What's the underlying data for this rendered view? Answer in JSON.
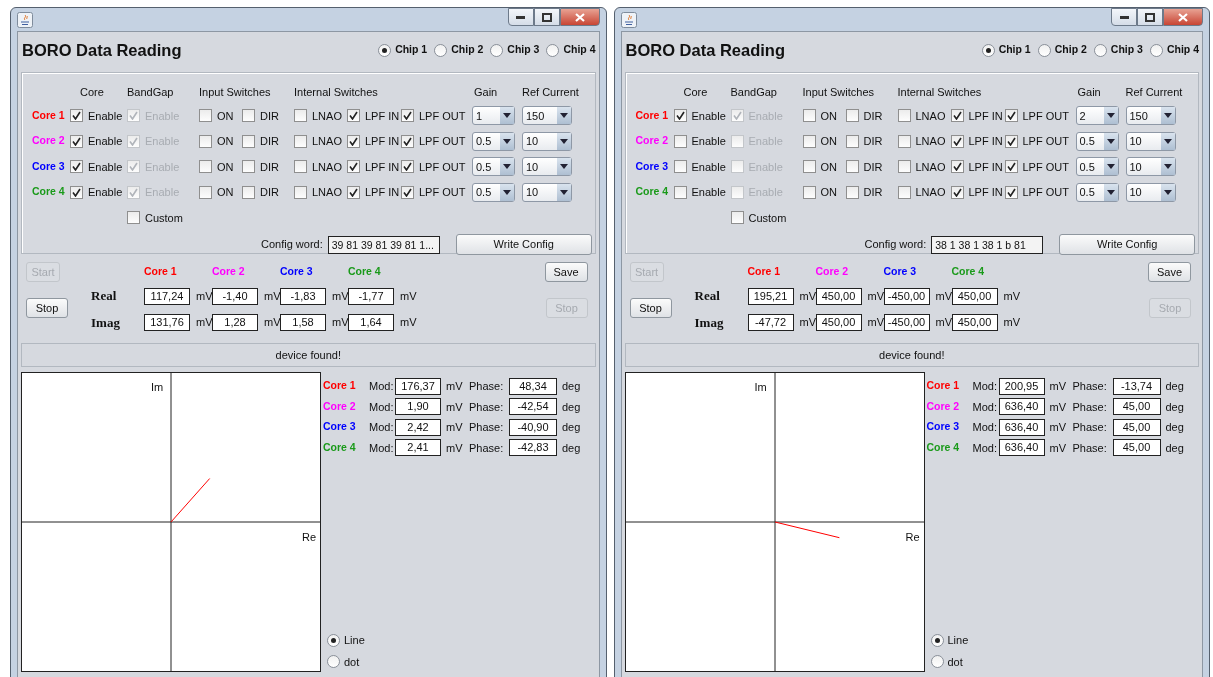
{
  "windows": [
    {
      "title": "BORO Data Reading",
      "chips": [
        {
          "label": "Chip 1",
          "selected": true
        },
        {
          "label": "Chip 2",
          "selected": false
        },
        {
          "label": "Chip 3",
          "selected": false
        },
        {
          "label": "Chip 4",
          "selected": false
        }
      ],
      "config": {
        "headers": [
          "Core",
          "BandGap",
          "Input Switches",
          "Internal Switches",
          "Gain",
          "Ref Current"
        ],
        "cores": [
          {
            "label": "Core 1",
            "color": "#ff0000",
            "switches": [
              {
                "label": "Enable",
                "checked": true,
                "disabled": false
              },
              {
                "label": "Enable",
                "checked": true,
                "disabled": true
              },
              {
                "label": "ON",
                "checked": false,
                "disabled": false
              },
              {
                "label": "DIR",
                "checked": false,
                "disabled": false
              },
              {
                "label": "LNAO",
                "checked": false,
                "disabled": false
              },
              {
                "label": "LPF IN",
                "checked": true,
                "disabled": false
              },
              {
                "label": "LPF OUT",
                "checked": true,
                "disabled": false
              }
            ],
            "gain": "1",
            "ref_current": "150"
          },
          {
            "label": "Core 2",
            "color": "#ff00ff",
            "switches": [
              {
                "label": "Enable",
                "checked": true,
                "disabled": false
              },
              {
                "label": "Enable",
                "checked": true,
                "disabled": true
              },
              {
                "label": "ON",
                "checked": false,
                "disabled": false
              },
              {
                "label": "DIR",
                "checked": false,
                "disabled": false
              },
              {
                "label": "LNAO",
                "checked": false,
                "disabled": false
              },
              {
                "label": "LPF IN",
                "checked": true,
                "disabled": false
              },
              {
                "label": "LPF OUT",
                "checked": true,
                "disabled": false
              }
            ],
            "gain": "0.5",
            "ref_current": "10"
          },
          {
            "label": "Core 3",
            "color": "#0000ff",
            "switches": [
              {
                "label": "Enable",
                "checked": true,
                "disabled": false
              },
              {
                "label": "Enable",
                "checked": true,
                "disabled": true
              },
              {
                "label": "ON",
                "checked": false,
                "disabled": false
              },
              {
                "label": "DIR",
                "checked": false,
                "disabled": false
              },
              {
                "label": "LNAO",
                "checked": false,
                "disabled": false
              },
              {
                "label": "LPF IN",
                "checked": true,
                "disabled": false
              },
              {
                "label": "LPF OUT",
                "checked": true,
                "disabled": false
              }
            ],
            "gain": "0.5",
            "ref_current": "10"
          },
          {
            "label": "Core 4",
            "color": "#1a9a1a",
            "switches": [
              {
                "label": "Enable",
                "checked": true,
                "disabled": false
              },
              {
                "label": "Enable",
                "checked": true,
                "disabled": true
              },
              {
                "label": "ON",
                "checked": false,
                "disabled": false
              },
              {
                "label": "DIR",
                "checked": false,
                "disabled": false
              },
              {
                "label": "LNAO",
                "checked": false,
                "disabled": false
              },
              {
                "label": "LPF IN",
                "checked": true,
                "disabled": false
              },
              {
                "label": "LPF OUT",
                "checked": true,
                "disabled": false
              }
            ],
            "gain": "0.5",
            "ref_current": "10"
          }
        ],
        "custom": {
          "label": "Custom",
          "checked": false
        },
        "config_word_label": "Config word:",
        "config_word": "39 81 39 81 39 81 1...",
        "write_button": "Write Config"
      },
      "acquisition": {
        "start": {
          "label": "Start",
          "disabled": true
        },
        "stop": {
          "label": "Stop",
          "disabled": false
        },
        "save": {
          "label": "Save",
          "disabled": false
        },
        "stop_right": {
          "label": "Stop",
          "disabled": true
        },
        "columns": [
          {
            "label": "Core 1",
            "color": "#ff0000"
          },
          {
            "label": "Core 2",
            "color": "#ff00ff"
          },
          {
            "label": "Core 3",
            "color": "#0000ff"
          },
          {
            "label": "Core 4",
            "color": "#1a9a1a"
          }
        ],
        "rows": [
          {
            "label": "Real",
            "cells": [
              {
                "value": "117,24",
                "unit": "mV"
              },
              {
                "value": "-1,40",
                "unit": "mV"
              },
              {
                "value": "-1,83",
                "unit": "mV"
              },
              {
                "value": "-1,77",
                "unit": "mV"
              }
            ]
          },
          {
            "label": "Imag",
            "cells": [
              {
                "value": "131,76",
                "unit": "mV"
              },
              {
                "value": "1,28",
                "unit": "mV"
              },
              {
                "value": "1,58",
                "unit": "mV"
              },
              {
                "value": "1,64",
                "unit": "mV"
              }
            ]
          }
        ]
      },
      "status": "device found!",
      "plot": {
        "im_label": "Im",
        "re_label": "Re"
      },
      "polar": [
        {
          "label": "Core 1",
          "color": "#ff0000",
          "mod_label": "Mod:",
          "mod": "176,37",
          "mod_unit": "mV",
          "phase_label": "Phase:",
          "phase": "48,34",
          "phase_unit": "deg"
        },
        {
          "label": "Core 2",
          "color": "#ff00ff",
          "mod_label": "Mod:",
          "mod": "1,90",
          "mod_unit": "mV",
          "phase_label": "Phase:",
          "phase": "-42,54",
          "phase_unit": "deg"
        },
        {
          "label": "Core 3",
          "color": "#0000ff",
          "mod_label": "Mod:",
          "mod": "2,42",
          "mod_unit": "mV",
          "phase_label": "Phase:",
          "phase": "-40,90",
          "phase_unit": "deg"
        },
        {
          "label": "Core 4",
          "color": "#1a9a1a",
          "mod_label": "Mod:",
          "mod": "2,41",
          "mod_unit": "mV",
          "phase_label": "Phase:",
          "phase": "-42,83",
          "phase_unit": "deg"
        }
      ],
      "plot_modes": [
        {
          "label": "Line",
          "selected": true
        },
        {
          "label": "dot",
          "selected": false
        }
      ]
    },
    {
      "title": "BORO Data Reading",
      "chips": [
        {
          "label": "Chip 1",
          "selected": true
        },
        {
          "label": "Chip 2",
          "selected": false
        },
        {
          "label": "Chip 3",
          "selected": false
        },
        {
          "label": "Chip 4",
          "selected": false
        }
      ],
      "config": {
        "headers": [
          "Core",
          "BandGap",
          "Input Switches",
          "Internal Switches",
          "Gain",
          "Ref Current"
        ],
        "cores": [
          {
            "label": "Core 1",
            "color": "#ff0000",
            "switches": [
              {
                "label": "Enable",
                "checked": true,
                "disabled": false
              },
              {
                "label": "Enable",
                "checked": true,
                "disabled": true
              },
              {
                "label": "ON",
                "checked": false,
                "disabled": false
              },
              {
                "label": "DIR",
                "checked": false,
                "disabled": false
              },
              {
                "label": "LNAO",
                "checked": false,
                "disabled": false
              },
              {
                "label": "LPF IN",
                "checked": true,
                "disabled": false
              },
              {
                "label": "LPF OUT",
                "checked": true,
                "disabled": false
              }
            ],
            "gain": "2",
            "ref_current": "150"
          },
          {
            "label": "Core 2",
            "color": "#ff00ff",
            "switches": [
              {
                "label": "Enable",
                "checked": false,
                "disabled": false
              },
              {
                "label": "Enable",
                "checked": false,
                "disabled": true
              },
              {
                "label": "ON",
                "checked": false,
                "disabled": false
              },
              {
                "label": "DIR",
                "checked": false,
                "disabled": false
              },
              {
                "label": "LNAO",
                "checked": false,
                "disabled": false
              },
              {
                "label": "LPF IN",
                "checked": true,
                "disabled": false
              },
              {
                "label": "LPF OUT",
                "checked": true,
                "disabled": false
              }
            ],
            "gain": "0.5",
            "ref_current": "10"
          },
          {
            "label": "Core 3",
            "color": "#0000ff",
            "switches": [
              {
                "label": "Enable",
                "checked": false,
                "disabled": false
              },
              {
                "label": "Enable",
                "checked": false,
                "disabled": true
              },
              {
                "label": "ON",
                "checked": false,
                "disabled": false
              },
              {
                "label": "DIR",
                "checked": false,
                "disabled": false
              },
              {
                "label": "LNAO",
                "checked": false,
                "disabled": false
              },
              {
                "label": "LPF IN",
                "checked": true,
                "disabled": false
              },
              {
                "label": "LPF OUT",
                "checked": true,
                "disabled": false
              }
            ],
            "gain": "0.5",
            "ref_current": "10"
          },
          {
            "label": "Core 4",
            "color": "#1a9a1a",
            "switches": [
              {
                "label": "Enable",
                "checked": false,
                "disabled": false
              },
              {
                "label": "Enable",
                "checked": false,
                "disabled": true
              },
              {
                "label": "ON",
                "checked": false,
                "disabled": false
              },
              {
                "label": "DIR",
                "checked": false,
                "disabled": false
              },
              {
                "label": "LNAO",
                "checked": false,
                "disabled": false
              },
              {
                "label": "LPF IN",
                "checked": true,
                "disabled": false
              },
              {
                "label": "LPF OUT",
                "checked": true,
                "disabled": false
              }
            ],
            "gain": "0.5",
            "ref_current": "10"
          }
        ],
        "custom": {
          "label": "Custom",
          "checked": false
        },
        "config_word_label": "Config word:",
        "config_word": "38 1 38 1 38 1 b 81",
        "write_button": "Write Config"
      },
      "acquisition": {
        "start": {
          "label": "Start",
          "disabled": true
        },
        "stop": {
          "label": "Stop",
          "disabled": false
        },
        "save": {
          "label": "Save",
          "disabled": false
        },
        "stop_right": {
          "label": "Stop",
          "disabled": true
        },
        "columns": [
          {
            "label": "Core 1",
            "color": "#ff0000"
          },
          {
            "label": "Core 2",
            "color": "#ff00ff"
          },
          {
            "label": "Core 3",
            "color": "#0000ff"
          },
          {
            "label": "Core 4",
            "color": "#1a9a1a"
          }
        ],
        "rows": [
          {
            "label": "Real",
            "cells": [
              {
                "value": "195,21",
                "unit": "mV"
              },
              {
                "value": "450,00",
                "unit": "mV"
              },
              {
                "value": "-450,00",
                "unit": "mV"
              },
              {
                "value": "450,00",
                "unit": "mV"
              }
            ]
          },
          {
            "label": "Imag",
            "cells": [
              {
                "value": "-47,72",
                "unit": "mV"
              },
              {
                "value": "450,00",
                "unit": "mV"
              },
              {
                "value": "-450,00",
                "unit": "mV"
              },
              {
                "value": "450,00",
                "unit": "mV"
              }
            ]
          }
        ]
      },
      "status": "device found!",
      "plot": {
        "im_label": "Im",
        "re_label": "Re"
      },
      "polar": [
        {
          "label": "Core 1",
          "color": "#ff0000",
          "mod_label": "Mod:",
          "mod": "200,95",
          "mod_unit": "mV",
          "phase_label": "Phase:",
          "phase": "-13,74",
          "phase_unit": "deg"
        },
        {
          "label": "Core 2",
          "color": "#ff00ff",
          "mod_label": "Mod:",
          "mod": "636,40",
          "mod_unit": "mV",
          "phase_label": "Phase:",
          "phase": "45,00",
          "phase_unit": "deg"
        },
        {
          "label": "Core 3",
          "color": "#0000ff",
          "mod_label": "Mod:",
          "mod": "636,40",
          "mod_unit": "mV",
          "phase_label": "Phase:",
          "phase": "45,00",
          "phase_unit": "deg"
        },
        {
          "label": "Core 4",
          "color": "#1a9a1a",
          "mod_label": "Mod:",
          "mod": "636,40",
          "mod_unit": "mV",
          "phase_label": "Phase:",
          "phase": "45,00",
          "phase_unit": "deg"
        }
      ],
      "plot_modes": [
        {
          "label": "Line",
          "selected": true
        },
        {
          "label": "dot",
          "selected": false
        }
      ]
    }
  ]
}
